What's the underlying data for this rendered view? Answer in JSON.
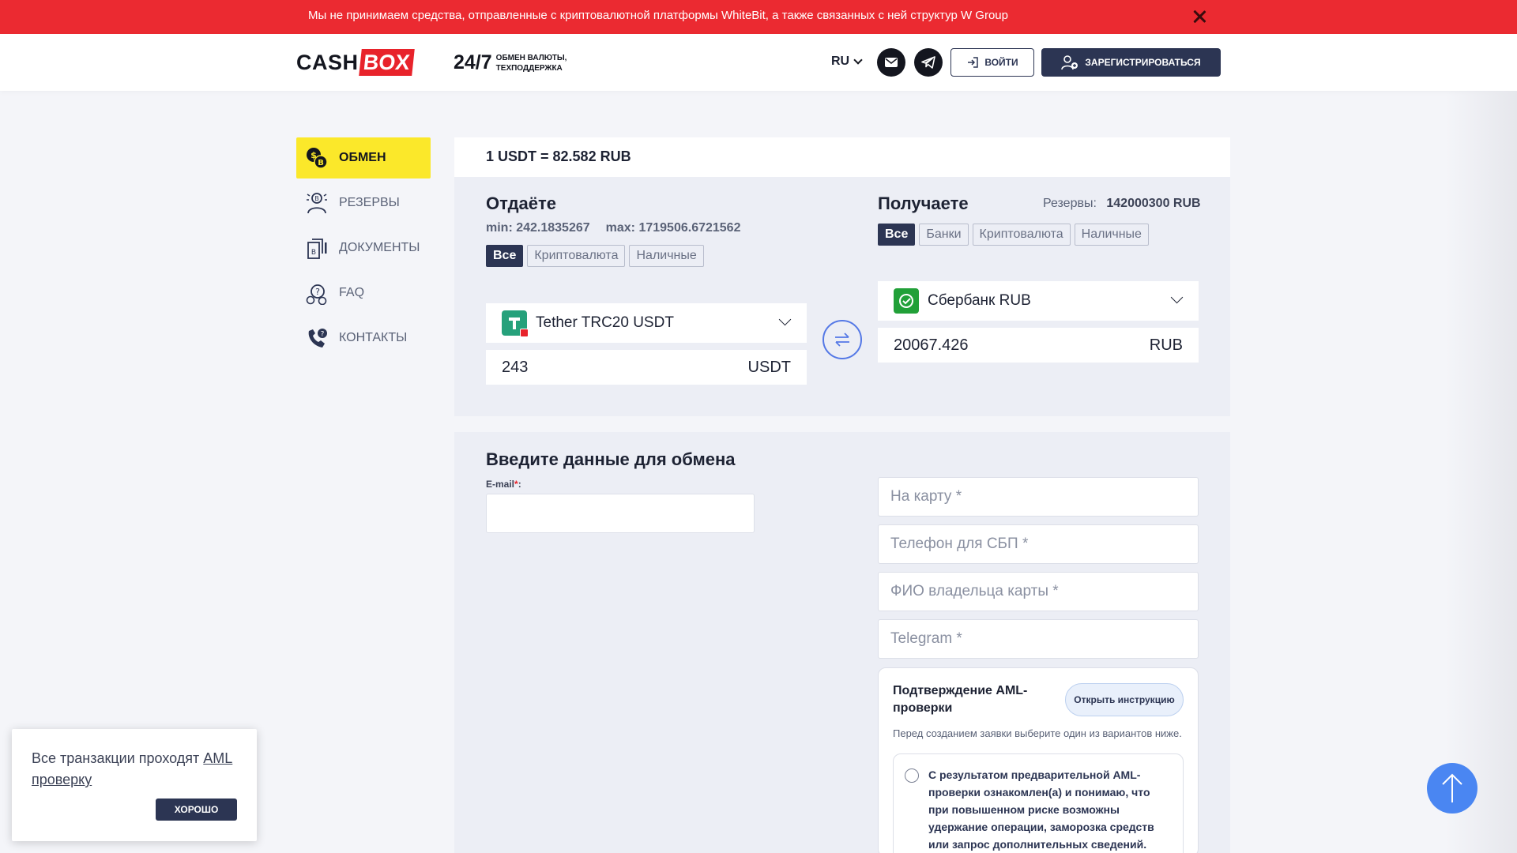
{
  "notice": {
    "text": "Мы не принимаем средства, отправленные с криптовалютной платформы WhiteBit, а также связанных с ней структур W Group"
  },
  "header": {
    "logo_part1": "CASH",
    "logo_part2": "BOX",
    "support_big": "24/7",
    "support_line1": "ОБМЕН ВАЛЮТЫ,",
    "support_line2": "ТЕХПОДДЕРЖКА",
    "lang": "RU",
    "login_label": "ВОЙТИ",
    "register_label": "ЗАРЕГИСТРИРОВАТЬСЯ"
  },
  "sidebar": {
    "items": [
      {
        "label": "ОБМЕН",
        "icon": "exchange-coins-icon",
        "active": true
      },
      {
        "label": "РЕЗЕРВЫ",
        "icon": "reserves-icon",
        "active": false
      },
      {
        "label": "ДОКУМЕНТЫ",
        "icon": "documents-icon",
        "active": false
      },
      {
        "label": "FAQ",
        "icon": "faq-icon",
        "active": false
      },
      {
        "label": "КОНТАКТЫ",
        "icon": "contacts-phone-icon",
        "active": false
      }
    ]
  },
  "exchange": {
    "rate": "1 USDT = 82.582 RUB",
    "give": {
      "title": "Отдаёте",
      "min": "min: 242.1835267",
      "max": "max: 1719506.6721562",
      "filters": [
        "Все",
        "Криптовалюта",
        "Наличные"
      ],
      "currency": "Tether TRC20 USDT",
      "amount": "243",
      "unit": "USDT"
    },
    "get": {
      "title": "Получаете",
      "reserves_label": "Резервы:",
      "reserves_value": "142000300 RUB",
      "filters": [
        "Все",
        "Банки",
        "Криптовалюта",
        "Наличные"
      ],
      "currency": "Сбербанк RUB",
      "amount": "20067.426",
      "unit": "RUB"
    }
  },
  "form": {
    "title": "Введите данные для обмена",
    "email_label": "E-mail",
    "email_req": "*",
    "email_colon": ":",
    "card_placeholder": "На карту *",
    "phone_placeholder": "Телефон для СБП *",
    "name_placeholder": "ФИО владельца карты *",
    "telegram_placeholder": "Telegram *",
    "aml": {
      "title": "Подтверждение AML-проверки",
      "button": "Открыть инструкцию",
      "hint": "Перед созданием заявки выберите один из вариантов ниже.",
      "option1": "С результатом предварительной AML-проверки ознакомлен(а) и понимаю, что при повышенном риске возможны удержание операции, заморозка средств или запрос дополнительных сведений."
    }
  },
  "cookie": {
    "text": "Все транзакции проходят",
    "link": "AML проверку",
    "button": "ХОРОШО"
  },
  "colors": {
    "notice_bg": "#eb2a31",
    "accent_yellow": "#fbe82a",
    "navy": "#2c3553",
    "blue": "#4a86f2"
  }
}
